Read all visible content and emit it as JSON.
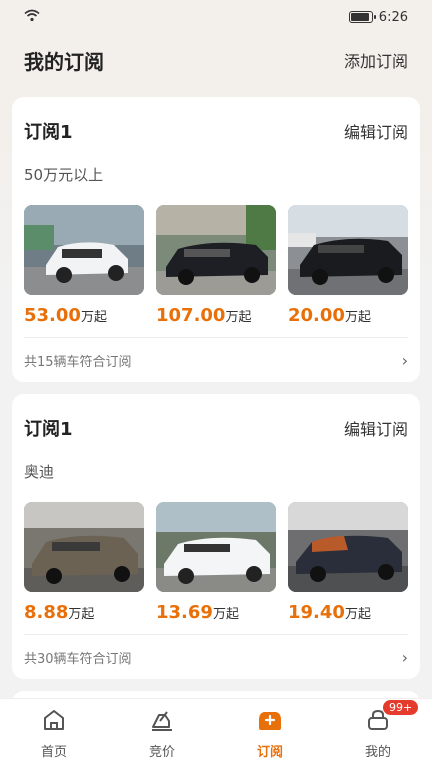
{
  "status": {
    "time": "6:26"
  },
  "header": {
    "title": "我的订阅",
    "add_label": "添加订阅"
  },
  "subscriptions": [
    {
      "title": "订阅1",
      "edit_label": "编辑订阅",
      "condition": "50万元以上",
      "cars": [
        {
          "price": "53.00",
          "unit": "万起"
        },
        {
          "price": "107.00",
          "unit": "万起"
        },
        {
          "price": "20.00",
          "unit": "万起"
        }
      ],
      "footer": "共15辆车符合订阅"
    },
    {
      "title": "订阅1",
      "edit_label": "编辑订阅",
      "condition": "奥迪",
      "cars": [
        {
          "price": "8.88",
          "unit": "万起"
        },
        {
          "price": "13.69",
          "unit": "万起"
        },
        {
          "price": "19.40",
          "unit": "万起"
        }
      ],
      "footer": "共30辆车符合订阅"
    }
  ],
  "tabbar": {
    "items": [
      {
        "label": "首页",
        "icon": "home-icon"
      },
      {
        "label": "竞价",
        "icon": "bid-icon"
      },
      {
        "label": "订阅",
        "icon": "subscribe-icon",
        "active": true
      },
      {
        "label": "我的",
        "icon": "profile-icon",
        "badge": "99+"
      }
    ]
  },
  "colors": {
    "accent": "#e8700a",
    "badge": "#e53b2c"
  }
}
